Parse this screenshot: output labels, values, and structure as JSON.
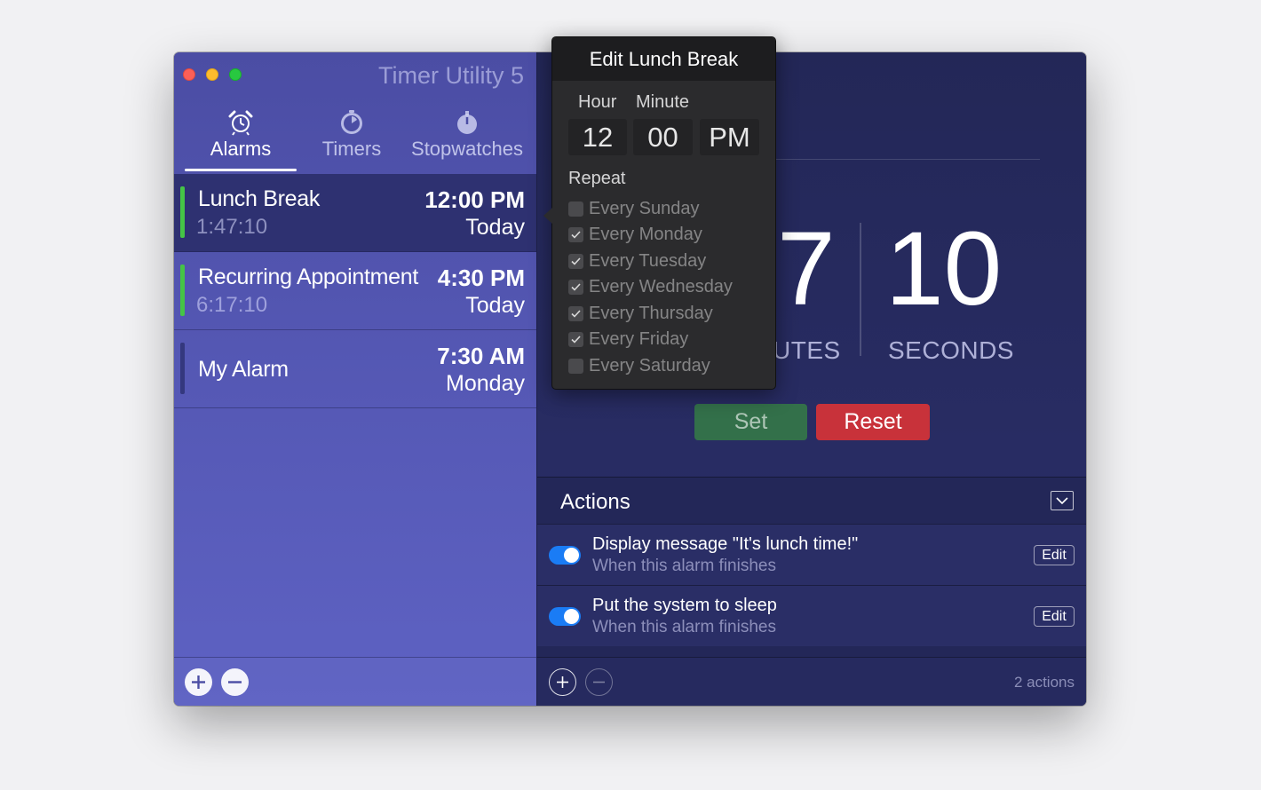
{
  "app": {
    "title": "Timer Utility 5"
  },
  "tabs": [
    {
      "label": "Alarms",
      "icon": "alarm-clock-icon",
      "active": true
    },
    {
      "label": "Timers",
      "icon": "timer-icon",
      "active": false
    },
    {
      "label": "Stopwatches",
      "icon": "stopwatch-icon",
      "active": false
    }
  ],
  "alarms": [
    {
      "name": "Lunch Break",
      "remaining": "1:47:10",
      "time": "12:00 PM",
      "day": "Today",
      "enabled": true,
      "selected": true
    },
    {
      "name": "Recurring Appointment",
      "remaining": "6:17:10",
      "time": "4:30 PM",
      "day": "Today",
      "enabled": true,
      "selected": false
    },
    {
      "name": "My Alarm",
      "remaining": "",
      "time": "7:30 AM",
      "day": "Monday",
      "enabled": false,
      "selected": false
    }
  ],
  "countdown": {
    "minutes_digit_visible": "7",
    "seconds": "10",
    "minutes_label_visible": "UTES",
    "seconds_label": "SECONDS"
  },
  "buttons": {
    "set": "Set",
    "reset": "Reset"
  },
  "actions": {
    "title": "Actions",
    "items": [
      {
        "title": "Display message \"It's lunch time!\"",
        "subtitle": "When this alarm finishes",
        "enabled": true,
        "edit_label": "Edit"
      },
      {
        "title": "Put the system to sleep",
        "subtitle": "When this alarm finishes",
        "enabled": true,
        "edit_label": "Edit"
      }
    ],
    "count_label": "2 actions"
  },
  "popover": {
    "title": "Edit Lunch Break",
    "hour_label": "Hour",
    "minute_label": "Minute",
    "hour": "12",
    "minute": "00",
    "ampm": "PM",
    "repeat_label": "Repeat",
    "days": [
      {
        "label": "Every Sunday",
        "checked": false
      },
      {
        "label": "Every Monday",
        "checked": true
      },
      {
        "label": "Every Tuesday",
        "checked": true
      },
      {
        "label": "Every Wednesday",
        "checked": true
      },
      {
        "label": "Every Thursday",
        "checked": true
      },
      {
        "label": "Every Friday",
        "checked": true
      },
      {
        "label": "Every Saturday",
        "checked": false
      }
    ]
  },
  "colors": {
    "sidebar": "#5457b3",
    "main_bg": "#262a5a",
    "enabled_bar": "#45c446",
    "set_button": "#33704a",
    "reset_button": "#c8323a",
    "toggle_on": "#1a7cf5",
    "popover_bg": "#2b2b2d"
  }
}
